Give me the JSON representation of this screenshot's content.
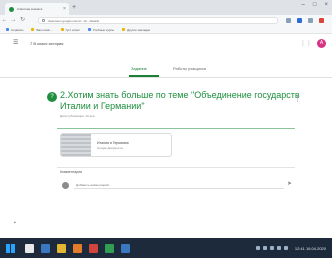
{
  "browser": {
    "tab_title": "Классная комната",
    "tab_close": "×",
    "new_tab": "+",
    "window_controls": [
      "–",
      "□",
      "×"
    ],
    "url": "classroom.google.com/c/.../a/.../details",
    "bookmarks": [
      "Сервисы",
      "Ваш комп...",
      "Гугл класс",
      "Учебные курсы",
      "Другие закладки"
    ]
  },
  "header": {
    "menu_icon": "☰",
    "class_name": "7 В класс история",
    "apps_icon": "⋮⋮",
    "avatar_letter": "А"
  },
  "tabs": {
    "instructions": "Задание",
    "student_work": "Работы учащихся"
  },
  "assignment": {
    "icon": "?",
    "title": "2.Хотим знать больше по теме \"Объединение государств Италии и Германии\"",
    "more_icon": "⋮",
    "meta": "Дата публикации: 16 апр."
  },
  "attachment": {
    "title": "Италия и Германия",
    "type": "Google Документы"
  },
  "comments": {
    "heading": "Комментарии",
    "placeholder": "Добавить комментарий...",
    "send_icon": "➤"
  },
  "taskbar": {
    "clock": "12:41 16.04.2020"
  },
  "colors": {
    "accent": "#1e8e3e",
    "taskbar": "#1c2a3c",
    "avatar": "#d63384"
  }
}
